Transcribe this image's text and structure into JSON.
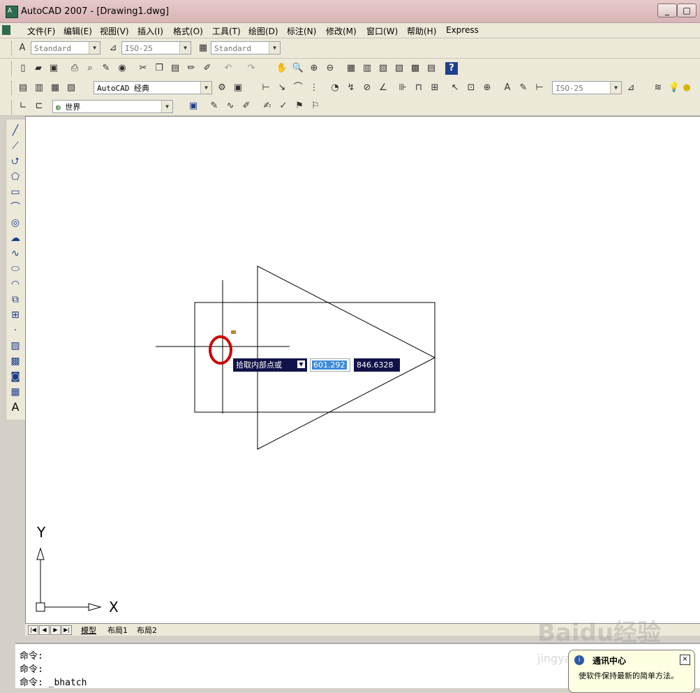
{
  "window": {
    "title": "AutoCAD 2007 - [Drawing1.dwg]",
    "app_icon": "autocad-icon",
    "controls": [
      "_",
      "□"
    ]
  },
  "menu": {
    "items": [
      "文件(F)",
      "编辑(E)",
      "视图(V)",
      "插入(I)",
      "格式(O)",
      "工具(T)",
      "绘图(D)",
      "标注(N)",
      "修改(M)",
      "窗口(W)",
      "帮助(H)",
      "Express"
    ]
  },
  "styles_toolbar": {
    "text_style": "Standard",
    "dim_style": "ISO-25",
    "table_style": "Standard"
  },
  "workspace_toolbar": {
    "workspace": "AutoCAD 经典",
    "dim_style_right": "ISO-25"
  },
  "ucs_toolbar": {
    "ucs": "世界"
  },
  "dynamic_input": {
    "prompt": "拾取内部点或",
    "x_value": "601.292",
    "y_value": "846.6328"
  },
  "ucs_icon": {
    "x_label": "X",
    "y_label": "Y"
  },
  "layout_tabs": [
    "模型",
    "布局1",
    "布局2"
  ],
  "command_lines": [
    "命令:",
    "命令:",
    "命令: _bhatch"
  ],
  "comm_center": {
    "title": "通讯中心",
    "message": "使软件保持最新的简单方法。",
    "close": "×"
  },
  "watermark": {
    "line1": "Baidu经验",
    "line2": "jingyan.baidu.com"
  },
  "highlight_color": "#cc0000"
}
